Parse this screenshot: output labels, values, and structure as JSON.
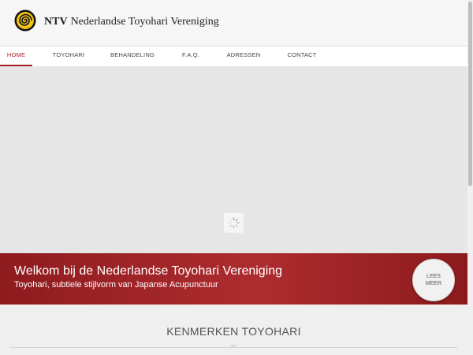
{
  "header": {
    "brand_short": "NTV",
    "brand_name": "Nederlandse Toyohari Vereniging",
    "logo_icon": "spiral-logo-icon"
  },
  "nav": {
    "items": [
      {
        "label": "HOME",
        "active": true
      },
      {
        "label": "TOYOHARI",
        "active": false
      },
      {
        "label": "BEHANDELING",
        "active": false
      },
      {
        "label": "F.A.Q.",
        "active": false
      },
      {
        "label": "ADRESSEN",
        "active": false
      },
      {
        "label": "CONTACT",
        "active": false
      }
    ],
    "active_color": "#a41e22"
  },
  "slider": {
    "loader_icon": "spinner-icon"
  },
  "banner": {
    "title": "Welkom bij de Nederlandse Toyohari Vereniging",
    "subtitle": "Toyohari, subtiele stijlvorm van Japanse Acupunctuur",
    "button_label": "LEES MEER",
    "color": "#a41e22"
  },
  "section": {
    "title": "KENMERKEN TOYOHARI"
  }
}
